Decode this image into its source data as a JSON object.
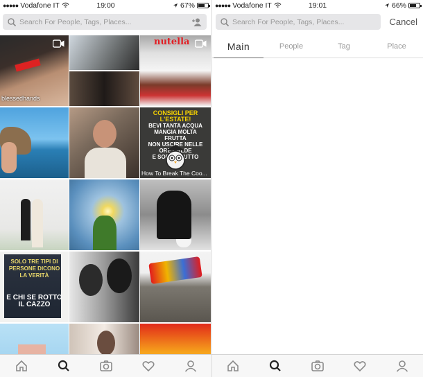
{
  "left_screen": {
    "status": {
      "carrier": "Vodafone IT",
      "time": "19:00",
      "battery": "67%",
      "battery_level": 0.67
    },
    "search": {
      "placeholder": "Search For People, Tags, Places..."
    },
    "grid": {
      "caption_blessed": "blessedhands",
      "poster": {
        "title": "CONSIGLI PER L'ESTATE!",
        "lines": "BEVI TANTA ACQUA\nMANGIA MOLTA FRUTTA\nNON USCIRE NELLE ORE CALDE\nE SOPRATTUTTO",
        "caption": "How To Break The Coo..."
      },
      "nutella_label": "nutella",
      "quote": {
        "top": "SOLO TRE TIPI DI PERSONE DICONO LA VERITÀ",
        "bottom": "E CHI SE ROTTO IL CAZZO"
      }
    },
    "tabbar": [
      "home-icon",
      "search-icon",
      "camera-icon",
      "heart-icon",
      "profile-icon"
    ]
  },
  "right_screen": {
    "status": {
      "carrier": "Vodafone IT",
      "time": "19:01",
      "battery": "66%",
      "battery_level": 0.66
    },
    "search": {
      "placeholder": "Search For People, Tags, Places..."
    },
    "cancel_label": "Cancel",
    "tabs": [
      "Main",
      "People",
      "Tag",
      "Place"
    ],
    "active_tab": "Main",
    "tabbar": [
      "home-icon",
      "search-icon",
      "camera-icon",
      "heart-icon",
      "profile-icon"
    ]
  },
  "colors": {
    "accent": "#222222",
    "tab_inactive": "#9a9a9a",
    "search_bg": "#e6e6e8"
  }
}
